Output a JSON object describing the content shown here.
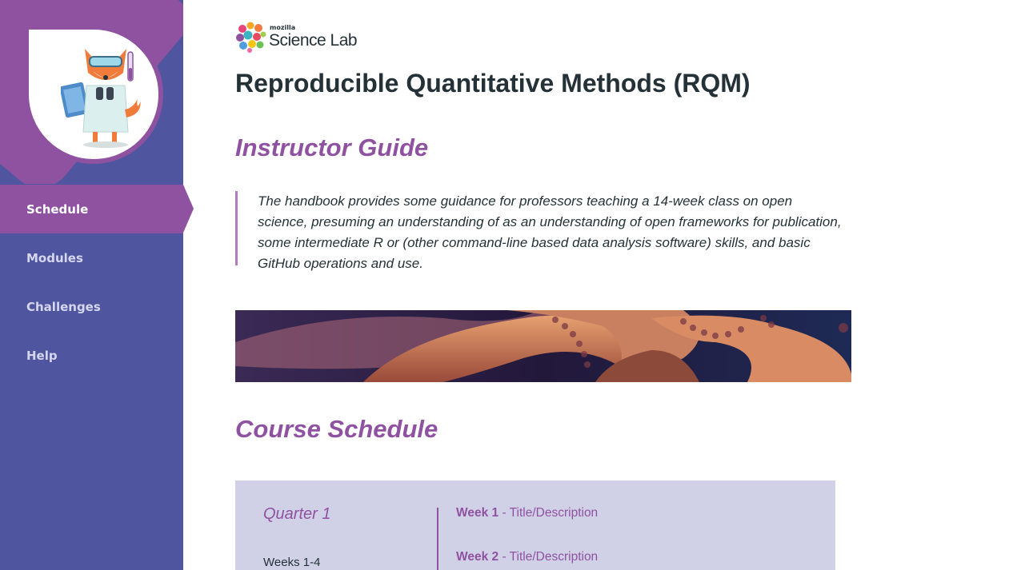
{
  "colors": {
    "sidebar": "#4f569f",
    "accent": "#8f52a1",
    "schedule_bg": "#d0d0e6",
    "text": "#243238"
  },
  "brand": {
    "small": "mozilla",
    "name": "Science Lab"
  },
  "sidebar": {
    "mascot_icon": "fox-scientist-icon",
    "items": [
      {
        "label": "Schedule",
        "active": true
      },
      {
        "label": "Modules",
        "active": false
      },
      {
        "label": "Challenges",
        "active": false
      },
      {
        "label": "Help",
        "active": false
      }
    ]
  },
  "main": {
    "page_title": "Reproducible Quantitative Methods (RQM)",
    "guide_title": "Instructor Guide",
    "intro": "The handbook provides some guidance for professors teaching a 14-week class on open science, presuming an understanding of as an understanding of open frameworks for publication, some intermediate R or (other command-line based data analysis software) skills, and basic GitHub operations and use.",
    "banner_image": "octopus-banner-image",
    "schedule_title": "Course Schedule",
    "schedule": {
      "quarter": "Quarter 1",
      "range": "Weeks 1-4",
      "weeks": [
        {
          "label": "Week 1",
          "desc": " - Title/Description"
        },
        {
          "label": "Week 2",
          "desc": " - Title/Description"
        }
      ]
    }
  }
}
